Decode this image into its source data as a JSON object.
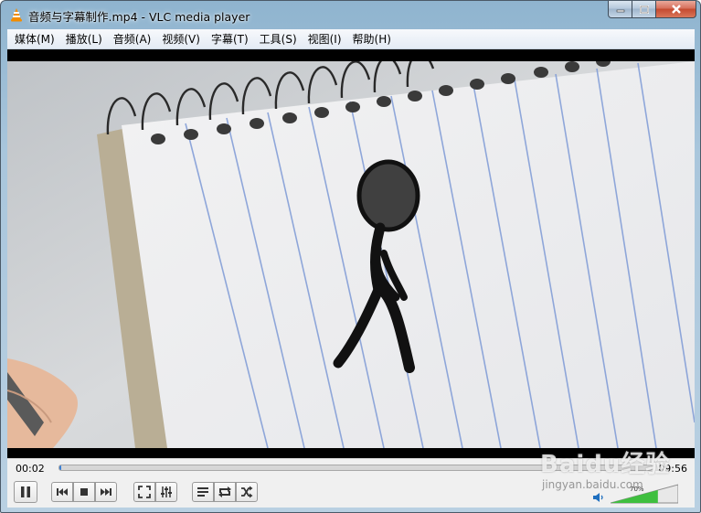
{
  "window": {
    "title": "音频与字幕制作.mp4 - VLC media player",
    "icon": "vlc-cone-icon"
  },
  "menu": [
    {
      "label": "媒体(M)"
    },
    {
      "label": "播放(L)"
    },
    {
      "label": "音频(A)"
    },
    {
      "label": "视频(V)"
    },
    {
      "label": "字幕(T)"
    },
    {
      "label": "工具(S)"
    },
    {
      "label": "视图(I)"
    },
    {
      "label": "帮助(H)"
    }
  ],
  "playback": {
    "elapsed": "00:02",
    "total": "09:56",
    "progress_fraction": 0.0034,
    "volume_label": "70%",
    "volume_fraction": 0.7
  },
  "buttons": {
    "pause": "pause-icon",
    "previous": "previous-icon",
    "stop": "stop-icon",
    "next": "next-icon",
    "fullscreen": "fullscreen-icon",
    "extended_settings": "equalizer-icon",
    "playlist": "playlist-icon",
    "loop": "loop-icon",
    "random": "shuffle-icon",
    "mute": "speaker-icon"
  },
  "watermark": {
    "text": "Baidu经验",
    "subtext": "jingyan.baidu.com"
  },
  "colors": {
    "accent": "#3b7fd4",
    "volume_green": "#3fbf3f",
    "close_red": "#c44a30"
  }
}
